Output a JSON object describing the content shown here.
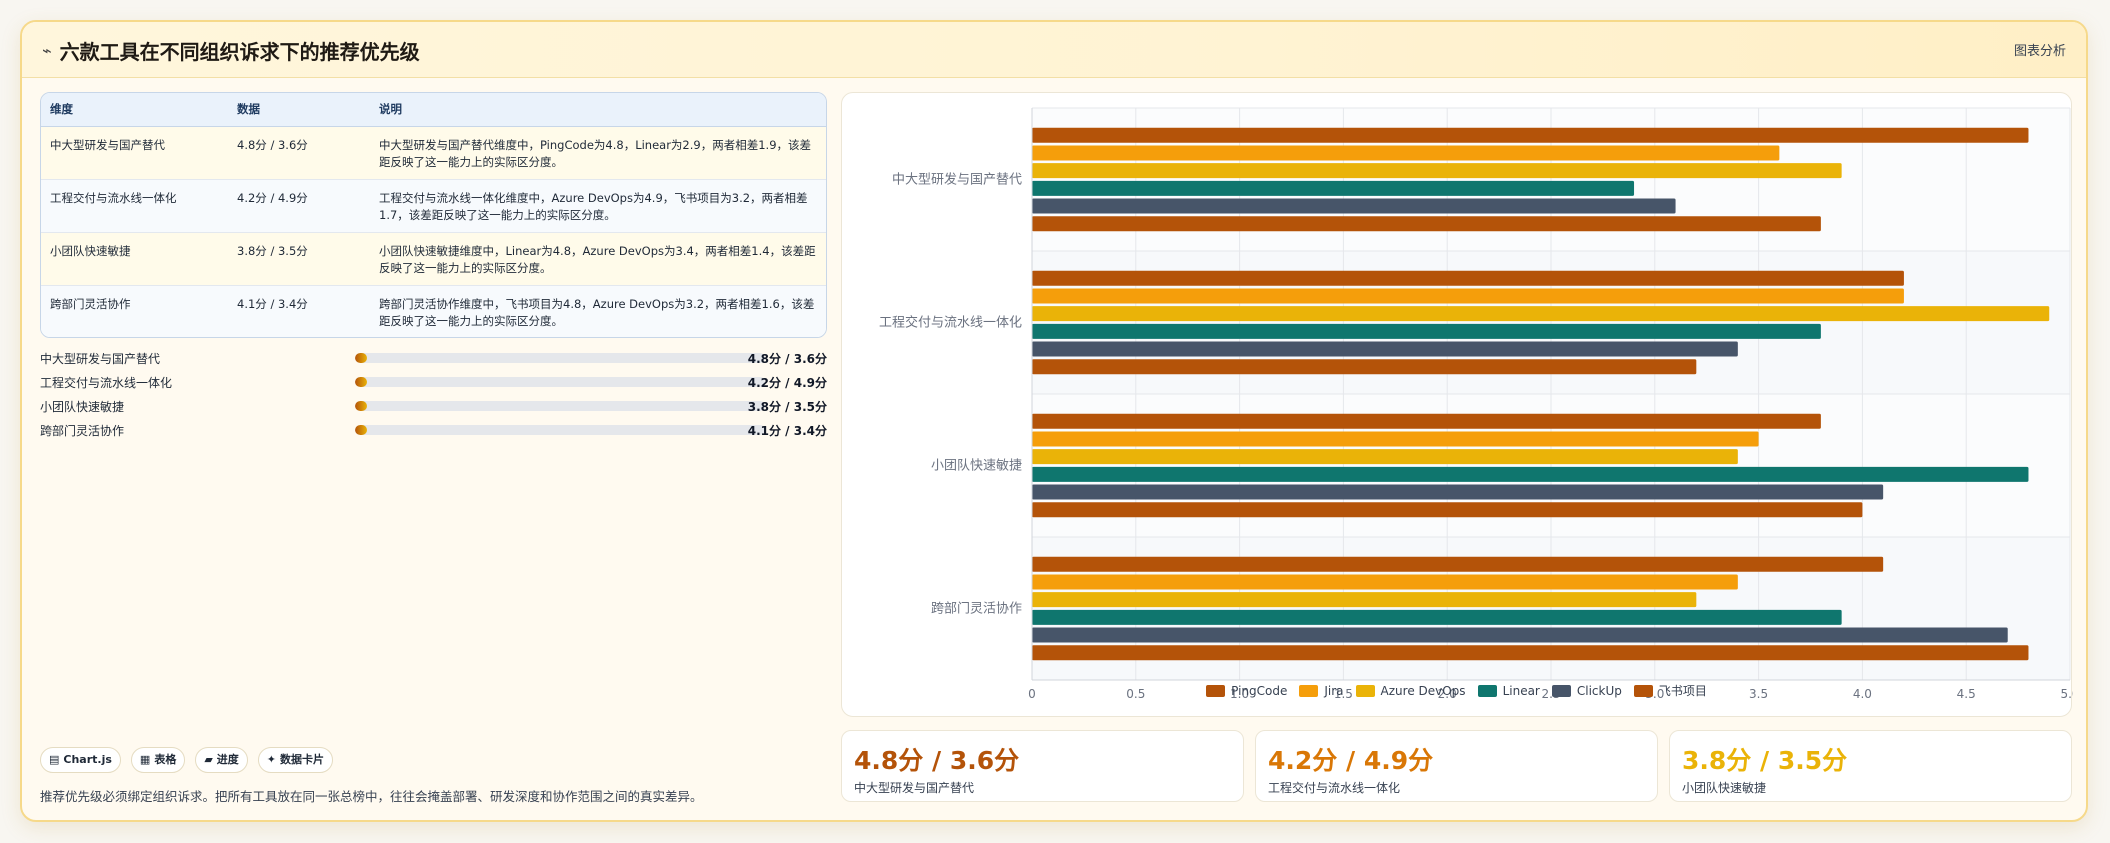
{
  "header": {
    "title": "六款工具在不同组织诉求下的推荐优先级",
    "title_icon": "pulse-icon",
    "tag": "图表分析"
  },
  "table": {
    "headers": [
      "维度",
      "数据",
      "说明"
    ],
    "rows": [
      [
        "中大型研发与国产替代",
        "4.8分 / 3.6分",
        "中大型研发与国产替代维度中，PingCode为4.8，Linear为2.9，两者相差1.9，该差距反映了这一能力上的实际区分度。"
      ],
      [
        "工程交付与流水线一体化",
        "4.2分 / 4.9分",
        "工程交付与流水线一体化维度中，Azure DevOps为4.9，飞书项目为3.2，两者相差1.7，该差距反映了这一能力上的实际区分度。"
      ],
      [
        "小团队快速敏捷",
        "3.8分 / 3.5分",
        "小团队快速敏捷维度中，Linear为4.8，Azure DevOps为3.4，两者相差1.4，该差距反映了这一能力上的实际区分度。"
      ],
      [
        "跨部门灵活协作",
        "4.1分 / 3.4分",
        "跨部门灵活协作维度中，飞书项目为4.8，Azure DevOps为3.2，两者相差1.6，该差距反映了这一能力上的实际区分度。"
      ]
    ]
  },
  "progress": [
    {
      "label": "中大型研发与国产替代",
      "value": "4.8分 / 3.6分",
      "fill_fraction": 0.03
    },
    {
      "label": "工程交付与流水线一体化",
      "value": "4.2分 / 4.9分",
      "fill_fraction": 0.03
    },
    {
      "label": "小团队快速敏捷",
      "value": "3.8分 / 3.5分",
      "fill_fraction": 0.03
    },
    {
      "label": "跨部门灵活协作",
      "value": "4.1分 / 3.4分",
      "fill_fraction": 0.03
    }
  ],
  "badges": [
    {
      "icon": "chart-icon",
      "glyph": "▤",
      "label": "Chart.js"
    },
    {
      "icon": "table-icon",
      "glyph": "▦",
      "label": "表格"
    },
    {
      "icon": "progress-icon",
      "glyph": "▰",
      "label": "进度"
    },
    {
      "icon": "card-icon",
      "glyph": "✦",
      "label": "数据卡片"
    }
  ],
  "note": "推荐优先级必须绑定组织诉求。把所有工具放在同一张总榜中，往往会掩盖部署、研发深度和协作范围之间的真实差异。",
  "stats": [
    {
      "value": "4.8分 / 3.6分",
      "label": "中大型研发与国产替代",
      "color": "#b45309"
    },
    {
      "value": "4.2分 / 4.9分",
      "label": "工程交付与流水线一体化",
      "color": "#d97706"
    },
    {
      "value": "3.8分 / 3.5分",
      "label": "小团队快速敏捷",
      "color": "#eab308"
    }
  ],
  "chart_data": {
    "type": "bar",
    "orientation": "horizontal",
    "categories": [
      "中大型研发与国产替代",
      "工程交付与流水线一体化",
      "小团队快速敏捷",
      "跨部门灵活协作"
    ],
    "series": [
      {
        "name": "PingCode",
        "color": "#b45309",
        "values": [
          4.8,
          4.2,
          3.8,
          4.1
        ]
      },
      {
        "name": "Jira",
        "color": "#f59e0b",
        "values": [
          3.6,
          4.2,
          3.5,
          3.4
        ]
      },
      {
        "name": "Azure DevOps",
        "color": "#eab308",
        "values": [
          3.9,
          4.9,
          3.4,
          3.2
        ]
      },
      {
        "name": "Linear",
        "color": "#0f766e",
        "values": [
          2.9,
          3.8,
          4.8,
          3.9
        ]
      },
      {
        "name": "ClickUp",
        "color": "#475569",
        "values": [
          3.1,
          3.4,
          4.1,
          4.7
        ]
      },
      {
        "name": "飞书项目",
        "color": "#b45309",
        "values": [
          3.8,
          3.2,
          4.0,
          4.8
        ]
      }
    ],
    "xlim": [
      0,
      5
    ],
    "xticks": [
      "0",
      "0.5",
      "1.0",
      "1.5",
      "2.0",
      "2.5",
      "3.0",
      "3.5",
      "4.0",
      "4.5",
      "5.0"
    ],
    "grid": true,
    "legend_position": "bottom"
  }
}
